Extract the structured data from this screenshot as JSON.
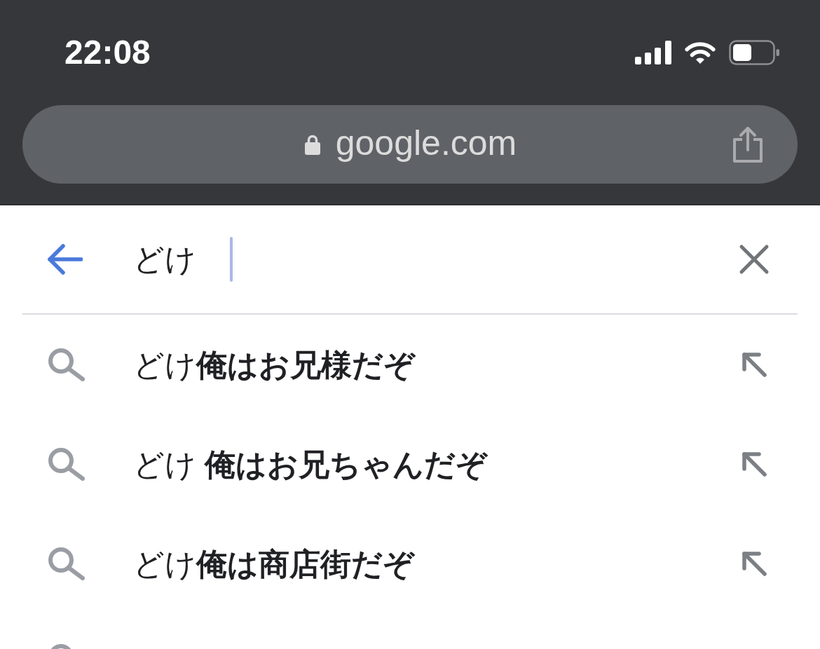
{
  "status_bar": {
    "time": "22:08"
  },
  "address_bar": {
    "url": "google.com"
  },
  "search": {
    "value": "どけ",
    "focused": true
  },
  "suggestions": [
    {
      "text": "どけ**俺はお兄様だぞ**"
    },
    {
      "text": "どけ **俺はお兄ちゃんだぞ**"
    },
    {
      "text": "どけ**俺は商店街だぞ**"
    }
  ]
}
